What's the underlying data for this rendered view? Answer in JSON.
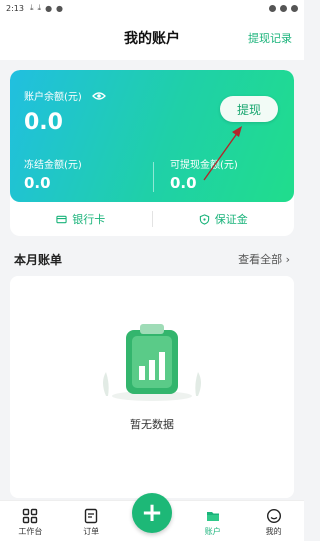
{
  "status_bar": {
    "time": "2:13"
  },
  "header": {
    "title": "我的账户",
    "record_link": "提现记录"
  },
  "balance_card": {
    "balance_label": "账户余额(元)",
    "balance_value": "0.0",
    "withdraw_button": "提现",
    "frozen_label": "冻结金额(元)",
    "frozen_value": "0.0",
    "available_label": "可提现金额(元)",
    "available_value": "0.0"
  },
  "card_links": {
    "bank_card": "银行卡",
    "deposit": "保证金"
  },
  "monthly_bill": {
    "title": "本月账单",
    "view_all": "查看全部",
    "empty_text": "暂无数据"
  },
  "tabs": [
    {
      "label": "工作台",
      "icon": "grid-icon"
    },
    {
      "label": "订单",
      "icon": "order-icon"
    },
    {
      "label": "",
      "icon": "plus-icon"
    },
    {
      "label": "账户",
      "icon": "wallet-icon",
      "active": true
    },
    {
      "label": "我的",
      "icon": "face-icon"
    }
  ],
  "colors": {
    "accent": "#19b37a",
    "card_start": "#21bfe0",
    "card_end": "#20dd8c"
  }
}
